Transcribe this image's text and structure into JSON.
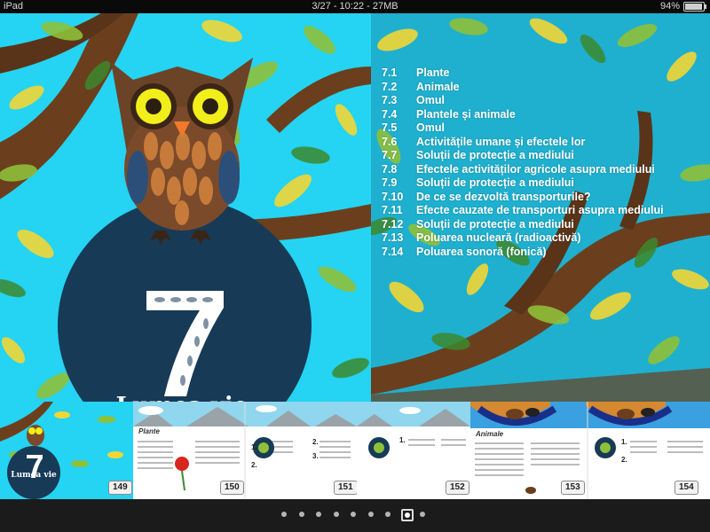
{
  "status_bar": {
    "device": "iPad",
    "center": "3/27 - 10:22 - 27MB",
    "battery": "94%",
    "battery_level": 0.94
  },
  "chapter": {
    "number": "7",
    "title": "Lumea vie"
  },
  "toc": [
    {
      "num": "7.1",
      "title": "Plante"
    },
    {
      "num": "7.2",
      "title": "Animale"
    },
    {
      "num": "7.3",
      "title": "Omul"
    },
    {
      "num": "7.4",
      "title": "Plantele și animale"
    },
    {
      "num": "7.5",
      "title": "Omul"
    },
    {
      "num": "7.6",
      "title": "Activitățile umane și efectele lor"
    },
    {
      "num": "7.7",
      "title": "Soluții de protecție a mediului"
    },
    {
      "num": "7.8",
      "title": "Efectele activităților agricole asupra mediului"
    },
    {
      "num": "7.9",
      "title": "Soluții de protecție a mediului"
    },
    {
      "num": "7.10",
      "title": "De ce se dezvoltă transporturile?"
    },
    {
      "num": "7.11",
      "title": "Efecte cauzate de transporturi asupra mediului"
    },
    {
      "num": "7.12",
      "title": "Soluții de protecție a mediului"
    },
    {
      "num": "7.13",
      "title": "Poluarea nucleară (radioactivă)"
    },
    {
      "num": "7.14",
      "title": "Poluarea sonoră (fonică)"
    }
  ],
  "thumbnails": {
    "page_numbers": [
      "149",
      "150",
      "151",
      "152",
      "153",
      "154"
    ],
    "thumb1_caption": "Lumea vie",
    "thumb2_heading": "Plante",
    "thumb4_heading": "Animale"
  },
  "page_dots": {
    "count": 9,
    "active_index": 7
  },
  "colors": {
    "sky_left": "#25d3f2",
    "sky_right": "#1fb0cf",
    "circle": "#173a57",
    "owl_brown": "#6b4427",
    "beak": "#f07a2a"
  }
}
